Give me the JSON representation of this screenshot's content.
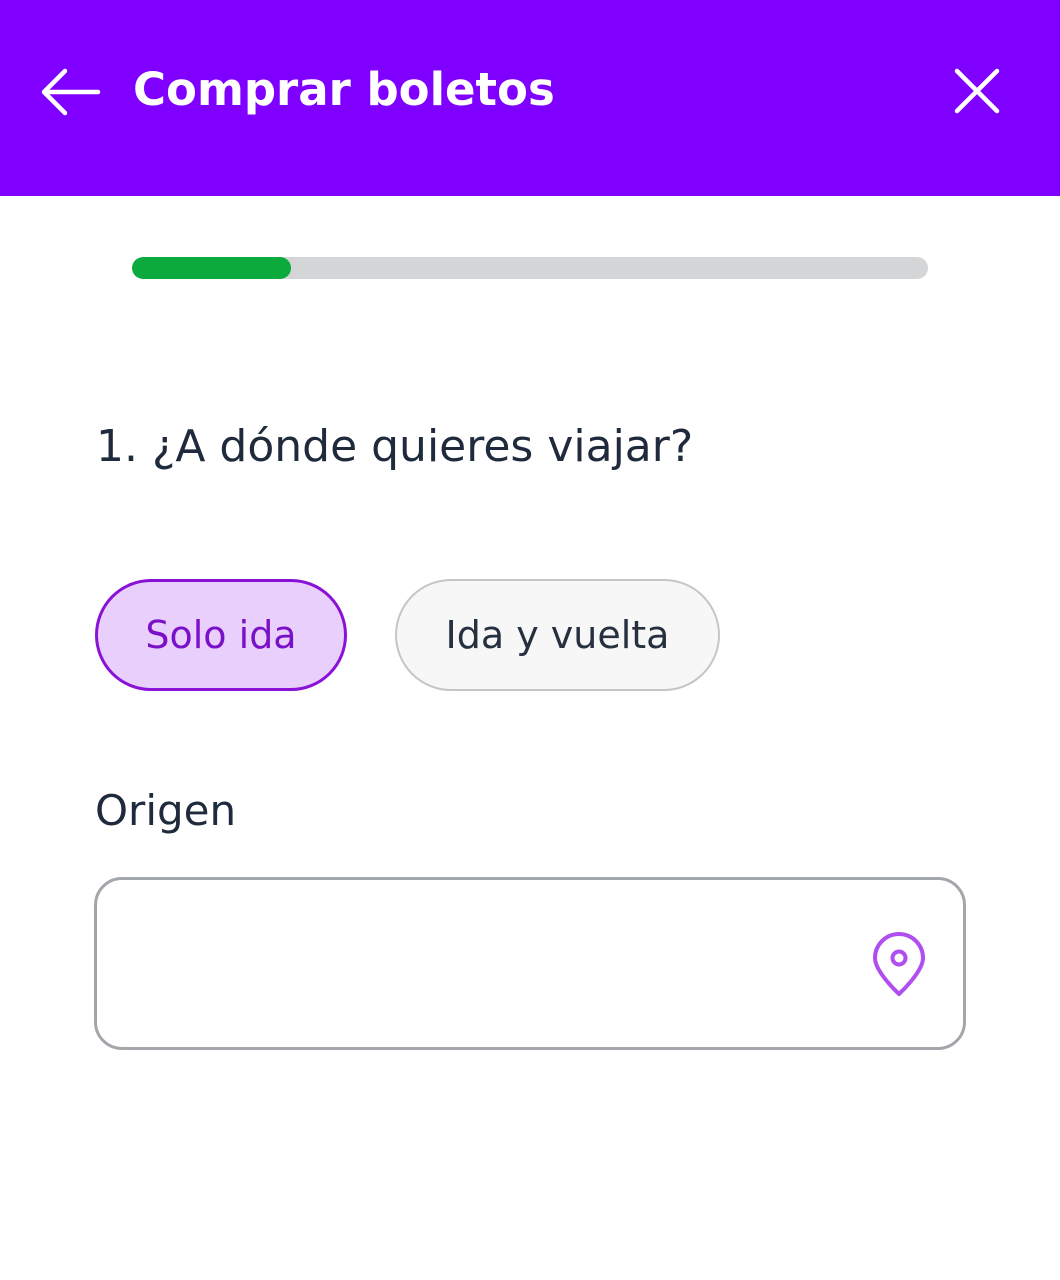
{
  "header": {
    "title": "Comprar boletos",
    "back_icon": "arrow-left-icon",
    "close_icon": "close-icon",
    "background_color": "#8000ff"
  },
  "progress": {
    "value_fraction": 0.2,
    "fill_color": "#0aaa3c",
    "track_color": "#d3d5d6"
  },
  "question": {
    "text": "1. ¿A dónde quieres viajar?"
  },
  "trip_type": {
    "options": [
      {
        "label": "Solo ida",
        "selected": true
      },
      {
        "label": "Ida y vuelta",
        "selected": false
      }
    ],
    "selected_color": "#8a12d6"
  },
  "origin": {
    "label": "Origen",
    "value": "",
    "placeholder": "",
    "icon": "location-pin-icon"
  }
}
